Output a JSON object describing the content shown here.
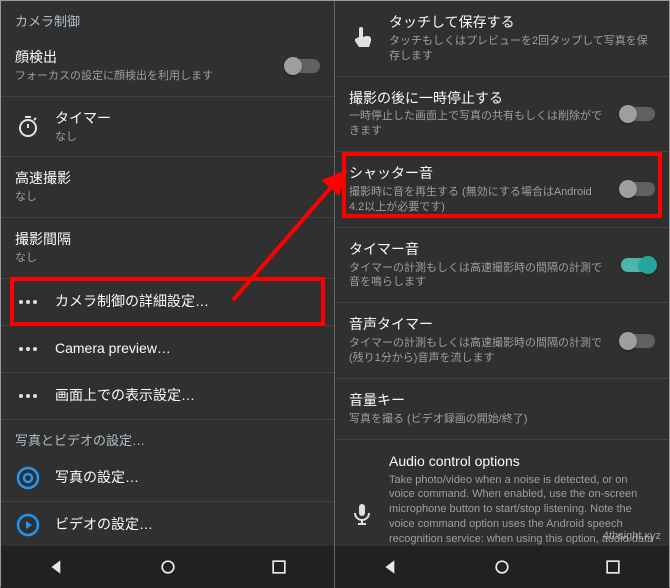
{
  "watermark": "4thsight.xyz",
  "left": {
    "section1": "カメラ制御",
    "faceDetect": {
      "title": "顔検出",
      "sub": "フォーカスの設定に顔検出を利用します"
    },
    "timer": {
      "title": "タイマー",
      "sub": "なし"
    },
    "burst": {
      "title": "高速撮影",
      "sub": "なし"
    },
    "interval": {
      "title": "撮影間隔",
      "sub": "なし"
    },
    "advanced": {
      "title": "カメラ制御の詳細設定…"
    },
    "preview": {
      "title": "Camera preview…"
    },
    "display": {
      "title": "画面上での表示設定…"
    },
    "section2": "写真とビデオの設定…",
    "photo": {
      "title": "写真の設定…"
    },
    "video": {
      "title": "ビデオの設定…"
    }
  },
  "right": {
    "touchSave": {
      "title": "タッチして保存する",
      "sub": "タッチもしくはプレビューを2回タップして写真を保存します"
    },
    "pause": {
      "title": "撮影の後に一時停止する",
      "sub": "一時停止した画面上で写真の共有もしくは削除ができます"
    },
    "shutter": {
      "title": "シャッター音",
      "sub": "撮影時に音を再生する (無効にする場合はAndroid 4.2以上が必要です)"
    },
    "timerSound": {
      "title": "タイマー音",
      "sub": "タイマーの計測もしくは高速撮影時の間隔の計測で音を鳴らします"
    },
    "voiceTimer": {
      "title": "音声タイマー",
      "sub": "タイマーの計測もしくは高速撮影時の間隔の計測で(残り1分から)音声を流します"
    },
    "volKey": {
      "title": "音量キー",
      "sub": "写真を撮る (ビデオ録画の開始/終了)"
    },
    "audio": {
      "title": "Audio control options",
      "sub": "Take photo/video when a noise is detected, or on voice command. When enabled, use the on-screen microphone button to start/stop listening. Note the voice command option uses the Android speech recognition service: when using this option, audio data is likely to be sent to remote servers to perform speech recognition."
    }
  }
}
